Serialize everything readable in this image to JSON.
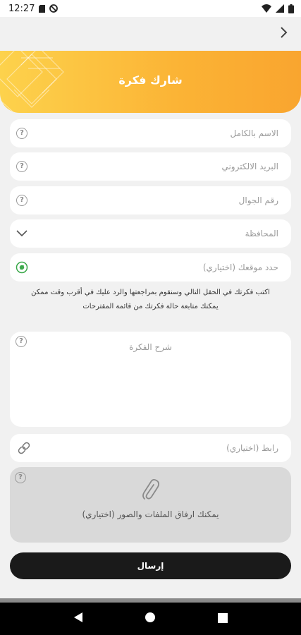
{
  "status_bar": {
    "time": "12:27",
    "icons": [
      "sim-card-icon",
      "blocked-notification-icon",
      "wifi-icon",
      "cellular-signal-icon",
      "battery-icon"
    ]
  },
  "app_bar": {
    "back_icon": "chevron-right-icon"
  },
  "header": {
    "title": "شارك فكرة",
    "background_colors": [
      "#fdd24c",
      "#f9a52f"
    ]
  },
  "form": {
    "full_name": {
      "placeholder": "الاسم بالكامل",
      "help_icon": "question-icon"
    },
    "email": {
      "placeholder": "البريد الالكتروني",
      "help_icon": "question-icon"
    },
    "mobile": {
      "placeholder": "رقم الجوال",
      "help_icon": "question-icon"
    },
    "governorate": {
      "placeholder": "المحافظة",
      "icon": "chevron-down-icon"
    },
    "location": {
      "placeholder": "حدد موقعك (اختياري)",
      "icon": "location-target-icon",
      "icon_color": "#3aa84a"
    },
    "hint_line1": "اكتب فكرتك في الحقل التالي وسنقوم بمراجعتها والرد عليك في أقرب وقت ممكن",
    "hint_line2": "يمكنك متابعة حالة فكرتك من قائمة المقترحات",
    "idea_description": {
      "placeholder": "شرح الفكرة",
      "help_icon": "question-icon"
    },
    "link": {
      "placeholder": "رابط (اختياري)",
      "icon": "link-icon"
    },
    "attachments": {
      "label": "يمكنك ارفاق الملفات والصور (اختياري)",
      "icon": "paperclip-icon",
      "help_icon": "question-icon"
    },
    "submit_label": "إرسال"
  },
  "nav_bar": {
    "icons": [
      "back-triangle-icon",
      "home-circle-icon",
      "recents-square-icon"
    ]
  }
}
